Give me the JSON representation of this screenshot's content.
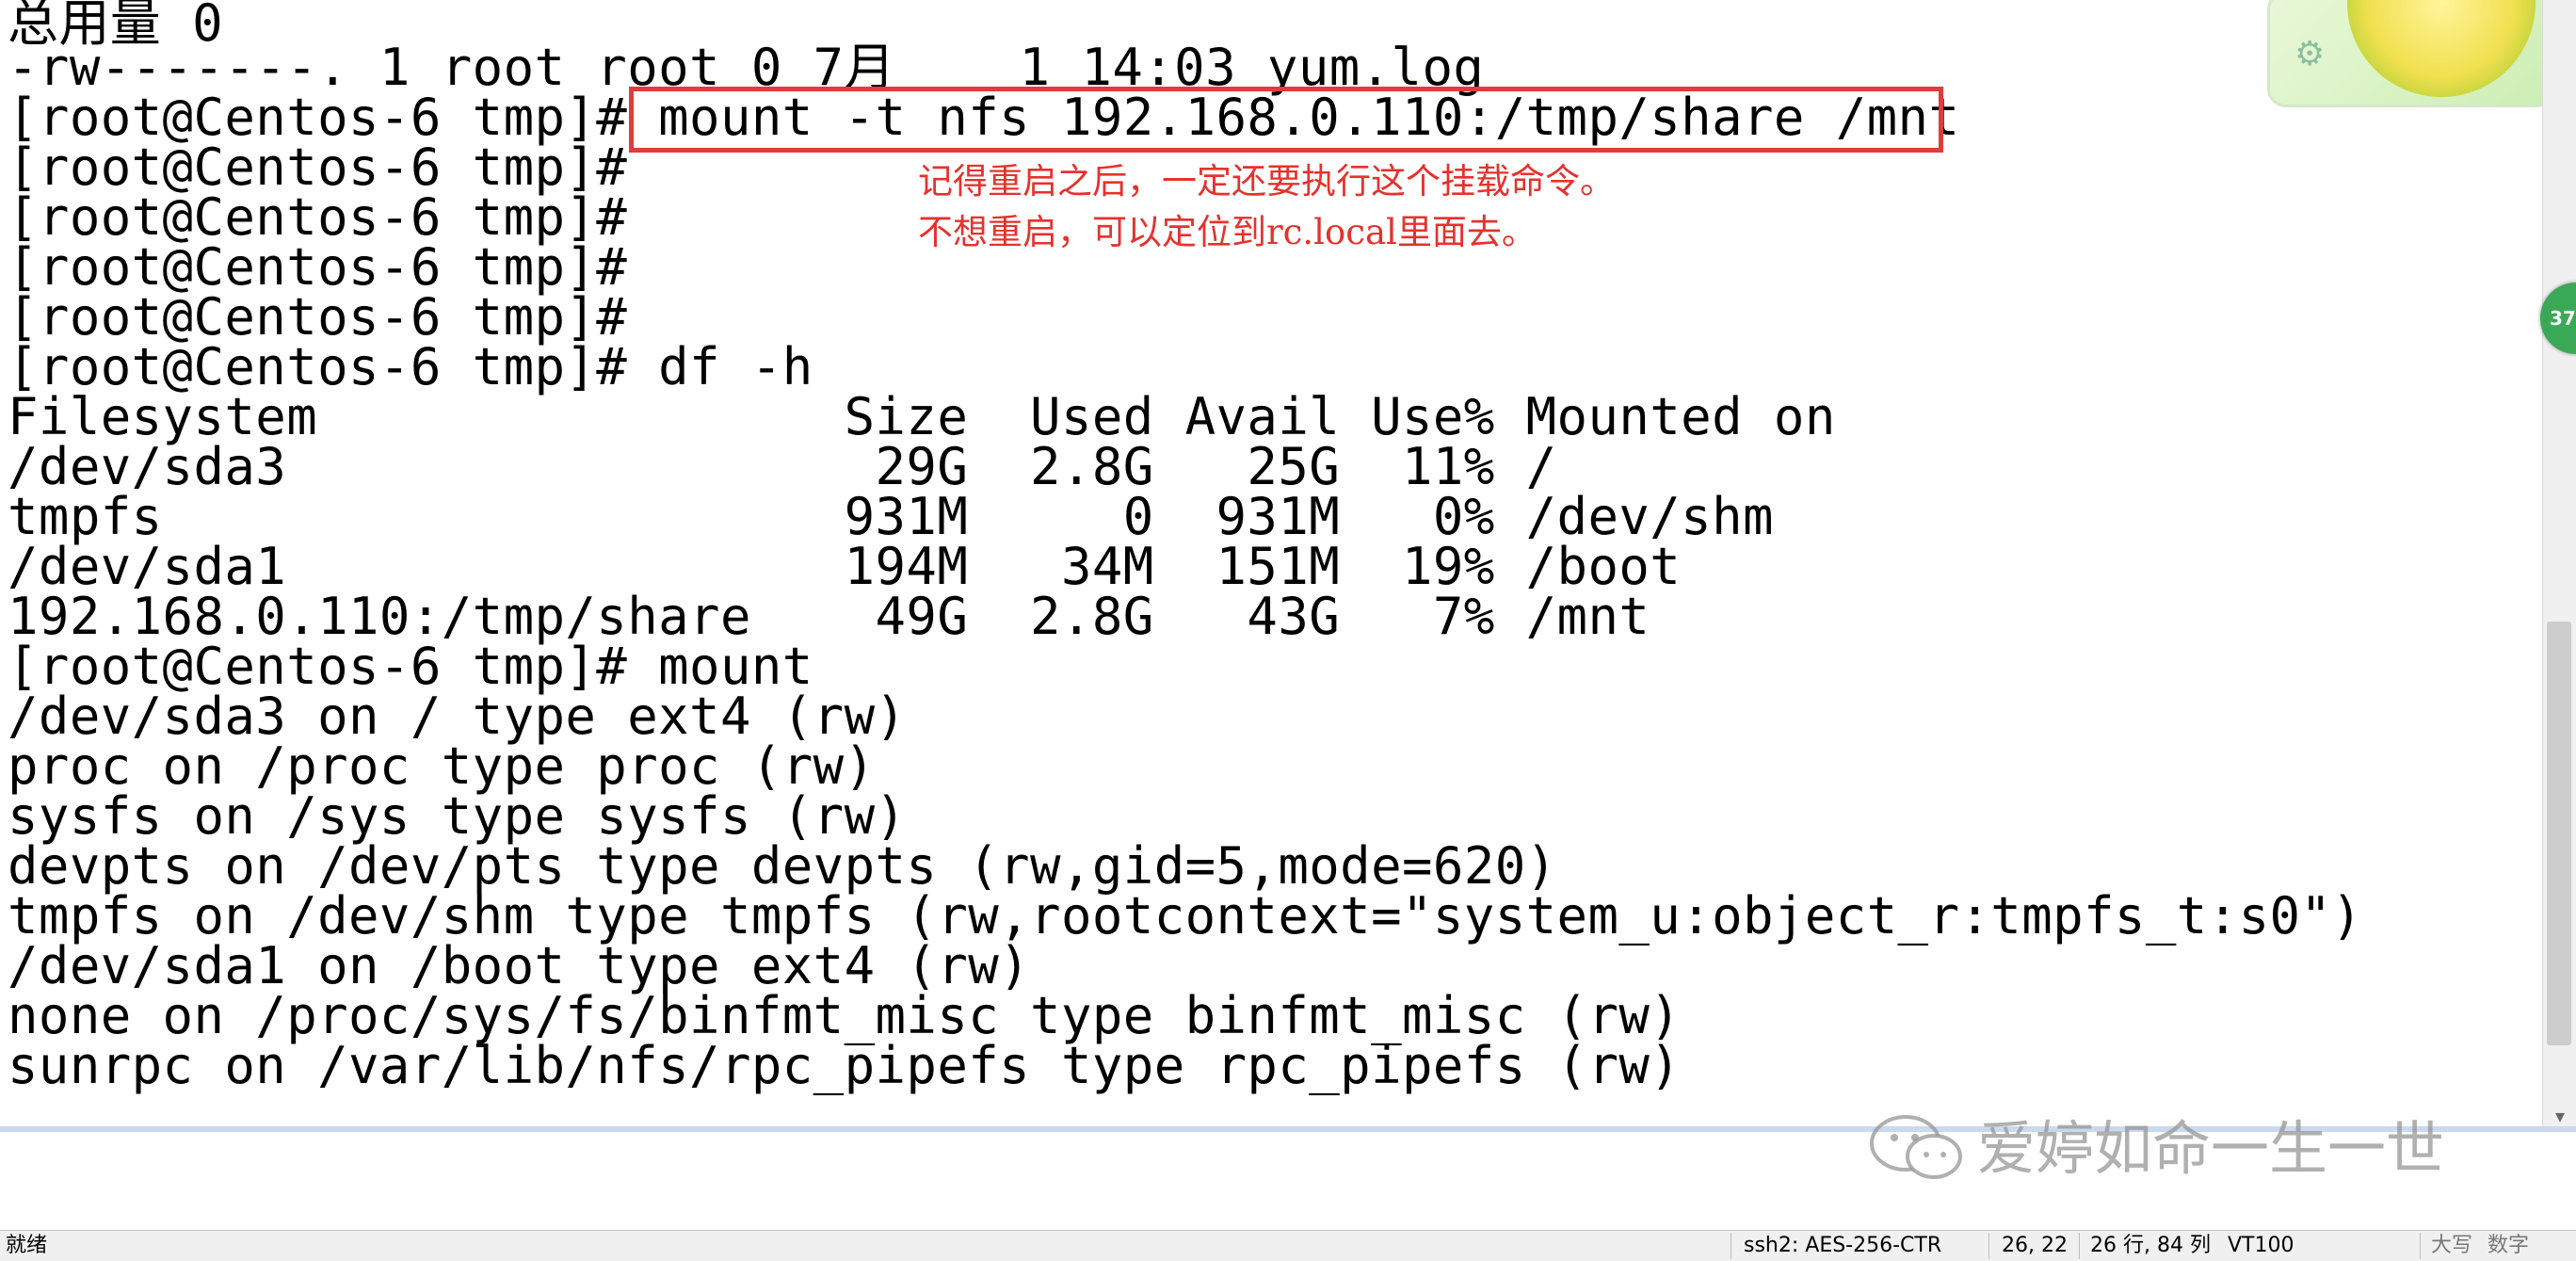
{
  "terminal": {
    "lines": [
      "总用量 0",
      "-rw-------. 1 root root 0 7月    1 14:03 yum.log",
      "[root@Centos-6 tmp]# mount -t nfs 192.168.0.110:/tmp/share /mnt",
      "[root@Centos-6 tmp]#",
      "[root@Centos-6 tmp]#",
      "[root@Centos-6 tmp]#",
      "[root@Centos-6 tmp]#",
      "[root@Centos-6 tmp]# df -h",
      "Filesystem                 Size  Used Avail Use% Mounted on",
      "/dev/sda3                   29G  2.8G   25G  11% /",
      "tmpfs                      931M     0  931M   0% /dev/shm",
      "/dev/sda1                  194M   34M  151M  19% /boot",
      "192.168.0.110:/tmp/share    49G  2.8G   43G   7% /mnt",
      "[root@Centos-6 tmp]# mount",
      "/dev/sda3 on / type ext4 (rw)",
      "proc on /proc type proc (rw)",
      "sysfs on /sys type sysfs (rw)",
      "devpts on /dev/pts type devpts (rw,gid=5,mode=620)",
      "tmpfs on /dev/shm type tmpfs (rw,rootcontext=\"system_u:object_r:tmpfs_t:s0\")",
      "/dev/sda1 on /boot type ext4 (rw)",
      "none on /proc/sys/fs/binfmt_misc type binfmt_misc (rw)",
      "sunrpc on /var/lib/nfs/rpc_pipefs type rpc_pipefs (rw)"
    ],
    "highlight_color": "#e03c3c"
  },
  "annotation": {
    "line1": "记得重启之后，一定还要执行这个挂载命令。",
    "line2": "不想重启，可以定位到rc.local里面去。",
    "color": "#e5322d"
  },
  "side_badge": "37",
  "watermark": "爱婷如命一生一世",
  "statusbar": {
    "ready": "就绪",
    "cipher": "ssh2: AES-256-CTR",
    "cursor": "26, 22",
    "size": "26 行, 84 列",
    "term": "VT100",
    "caps": "大写",
    "num": "数字"
  }
}
